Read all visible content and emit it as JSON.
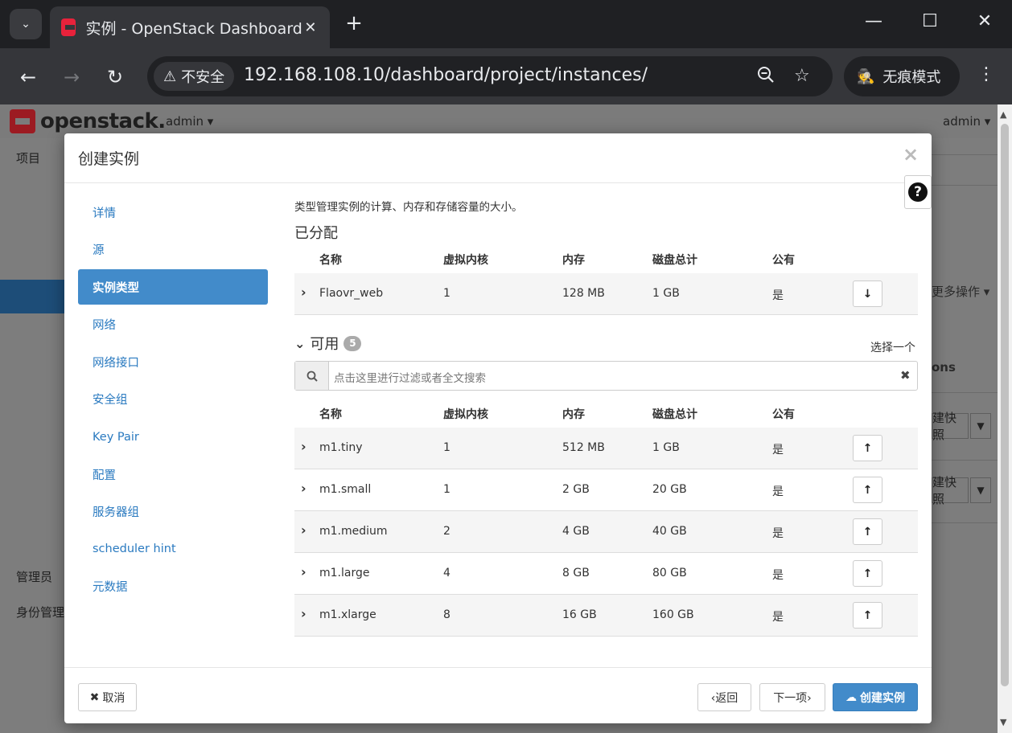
{
  "browser": {
    "tab_title": "实例 - OpenStack Dashboard",
    "security_label": "不安全",
    "url": "192.168.108.10/dashboard/project/instances/",
    "incognito_label": "无痕模式"
  },
  "page_bg": {
    "logo_text": "openstack.",
    "project_selector": "admin ▾",
    "user_menu": "admin ▾",
    "sidebar_project": "项目",
    "sidebar_admin": "管理员",
    "sidebar_identity": "身份管理",
    "more_actions": "更多操作 ▾",
    "col_actions_partial": "ons",
    "snapshot_btn": "建快照"
  },
  "modal": {
    "title": "创建实例",
    "close": "×",
    "help": "?"
  },
  "wizard_nav": {
    "items": [
      {
        "label": "详情"
      },
      {
        "label": "源"
      },
      {
        "label": "实例类型"
      },
      {
        "label": "网络"
      },
      {
        "label": "网络接口"
      },
      {
        "label": "安全组"
      },
      {
        "label": "Key Pair"
      },
      {
        "label": "配置"
      },
      {
        "label": "服务器组"
      },
      {
        "label": "scheduler hint"
      },
      {
        "label": "元数据"
      }
    ],
    "active_index": 2
  },
  "flavor": {
    "description": "类型管理实例的计算、内存和存储容量的大小。",
    "allocated_title": "已分配",
    "columns": [
      "名称",
      "虚拟内核",
      "内存",
      "磁盘总计",
      "公有"
    ],
    "allocated": [
      {
        "name": "Flaovr_web",
        "vcpus": "1",
        "ram": "128 MB",
        "disk": "1 GB",
        "public": "是"
      }
    ],
    "available_title": "可用",
    "available_count": "5",
    "select_one": "选择一个",
    "search_placeholder": "点击这里进行过滤或者全文搜索",
    "available": [
      {
        "name": "m1.tiny",
        "vcpus": "1",
        "ram": "512 MB",
        "disk": "1 GB",
        "public": "是"
      },
      {
        "name": "m1.small",
        "vcpus": "1",
        "ram": "2 GB",
        "disk": "20 GB",
        "public": "是"
      },
      {
        "name": "m1.medium",
        "vcpus": "2",
        "ram": "4 GB",
        "disk": "40 GB",
        "public": "是"
      },
      {
        "name": "m1.large",
        "vcpus": "4",
        "ram": "8 GB",
        "disk": "80 GB",
        "public": "是"
      },
      {
        "name": "m1.xlarge",
        "vcpus": "8",
        "ram": "16 GB",
        "disk": "160 GB",
        "public": "是"
      }
    ]
  },
  "footer": {
    "cancel": "取消",
    "back": "‹返回",
    "next": "下一项›",
    "launch": "创建实例"
  },
  "colors": {
    "accent": "#428bca",
    "link": "#2a7ac0",
    "brand_red": "#e8223b"
  }
}
